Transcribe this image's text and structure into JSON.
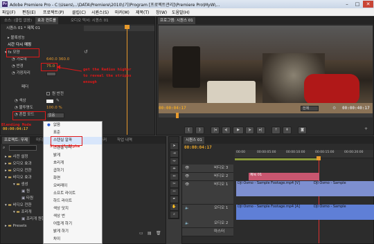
{
  "window": {
    "title": "Adobe Premiere Pro - C:\\Users\\...\\DATA\\Premiere\\2010\\(기)Program [프로젝트관리]\\Premiere Pro\\MyW\\...",
    "app_icon": "Pr"
  },
  "menu": [
    "파일(F)",
    "편집(E)",
    "프로젝트(P)",
    "클립(C)",
    "시퀀스(S)",
    "마커(M)",
    "제목(T)",
    "창(W)",
    "도움말(H)"
  ],
  "effect_controls": {
    "tabs": [
      "소스: (클립 없음)",
      "효과 컨트롤",
      "오디오 믹서: 시퀀스 01"
    ],
    "active_tab": 1,
    "sequence_label": "시퀀스 01 * 제목 01",
    "rows": [
      {
        "label": "볼록성능",
        "value": ""
      },
      {
        "label": "시간 다시 매핑",
        "value": ""
      },
      {
        "label": "모양",
        "value": ""
      },
      {
        "label": "가로대",
        "value": "640.0   360.0"
      },
      {
        "label": "반경",
        "value": "75.0"
      },
      {
        "label": "가장자리",
        "value": ""
      },
      {
        "label": "",
        "value": ""
      },
      {
        "label": "페더",
        "value": ""
      },
      {
        "label": "",
        "value": "원 반전"
      },
      {
        "label": "색상",
        "value": ""
      },
      {
        "label": "불투명도",
        "value": "100.0 %"
      },
      {
        "label": "혼합 모드",
        "value": "없음"
      }
    ],
    "timecode": "00:00:04:17"
  },
  "annotations": {
    "radius_note_line1": "get the Radius higher",
    "radius_note_line2": "to reveal the stripes",
    "radius_note_line3": "enough",
    "blending_label": "Blending Mode",
    "stencil_label": "Stencil Alpha"
  },
  "blend_menu": {
    "items": [
      "없음",
      "표준",
      "스텐실 알파",
      "스텐실 루마",
      "밝게",
      "흐리게",
      "곱하기",
      "화면",
      "오버레이",
      "소프트 라이트",
      "하드 라이트",
      "색상 닷지",
      "색상 번",
      "어둡게 하기",
      "밝게 하기",
      "차이",
      "제외"
    ],
    "checked_index": 0,
    "selected_index": 2
  },
  "program_monitor": {
    "tab": "프로그램: 시퀀스 01",
    "timecode_left": "00:00:04:17",
    "fit_label": "전체",
    "timecode_right": "00:00:40:17"
  },
  "project_panel": {
    "tabs": [
      "프로젝트: 무제",
      "미디어 브라우저",
      "정보",
      "효과",
      "마커",
      "작업 내역"
    ],
    "search_placeholder": "",
    "items": [
      "사전 설정",
      "오디오 효과",
      "오디오 전환",
      "비디오 효과",
      "생성",
      "원",
      "타원",
      "비디오 전환",
      "조리개",
      "조리개 원형",
      "Presets"
    ]
  },
  "timeline": {
    "tab": "시퀀스 01",
    "timecode": "00:00:04:17",
    "ruler": [
      "00:00",
      "00:00:05:00",
      "00:00:10:00",
      "00:00:15:00",
      "00:00:20:00"
    ],
    "tracks": [
      "비디오 3",
      "비디오 2",
      "비디오 1",
      "",
      "오디오 1",
      "오디오 2",
      "마스터"
    ],
    "clips": {
      "title": "제목 01",
      "v1a": "DJI Osmo - Sample Footage.mp4 [V]",
      "v1b": "DJI Osmo - Sample",
      "a1a": "DJI Osmo - Sample Footage.mp4 [A]",
      "a1b": "DJI Osmo - Sample"
    }
  },
  "colors": {
    "accent": "#e89a2c",
    "annotation": "#e01818",
    "title_clip": "#c8566f",
    "video_clip": "#7d8fd0",
    "audio_clip": "#5f7fd6"
  }
}
